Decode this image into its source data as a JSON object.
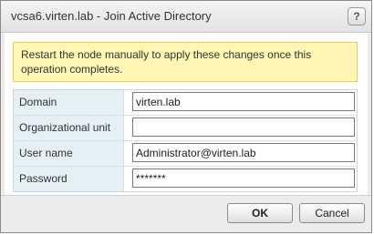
{
  "dialog": {
    "title": "vcsa6.virten.lab - Join Active Directory",
    "help_glyph": "?"
  },
  "warning": {
    "text": "Restart the node manually to apply these changes once this operation completes."
  },
  "form": {
    "fields": [
      {
        "label": "Domain",
        "value": "virten.lab"
      },
      {
        "label": "Organizational unit",
        "value": ""
      },
      {
        "label": "User name",
        "value": "Administrator@virten.lab"
      },
      {
        "label": "Password",
        "value": "*******"
      }
    ]
  },
  "buttons": {
    "ok": "OK",
    "cancel": "Cancel"
  }
}
